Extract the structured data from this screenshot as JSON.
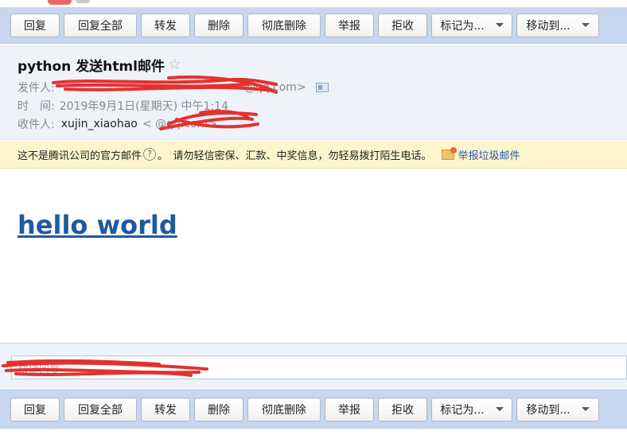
{
  "toolbar": {
    "buttons": [
      "回复",
      "回复全部",
      "转发",
      "删除",
      "彻底删除",
      "举报",
      "拒收"
    ],
    "dropdowns": [
      "标记为...",
      "移动到..."
    ]
  },
  "email": {
    "subject": "python 发送html邮件",
    "from_label": "发件人:",
    "from_value": "@qq.com>",
    "time_label": "时　间:",
    "time_value": "2019年9月1日(星期天) 中午1:14",
    "to_label": "收件人:",
    "to_name": "xujin_xiaohao",
    "to_value": "<         @qq.com>"
  },
  "warning": {
    "text1": "这不是腾讯公司的官方邮件",
    "text2": "。　请勿轻信密保、汇款、中奖信息，勿轻易拨打陌生电话。",
    "report_link": "举报垃圾邮件"
  },
  "body": {
    "heading": "hello world"
  },
  "reply": {
    "placeholder": "快捷回复"
  },
  "colors": {
    "toolbar_bg": "#c6d7ef",
    "header_bg": "#eef3fa",
    "warning_bg": "#fff5cc",
    "link": "#1f5aa0",
    "redaction": "#e53030"
  }
}
